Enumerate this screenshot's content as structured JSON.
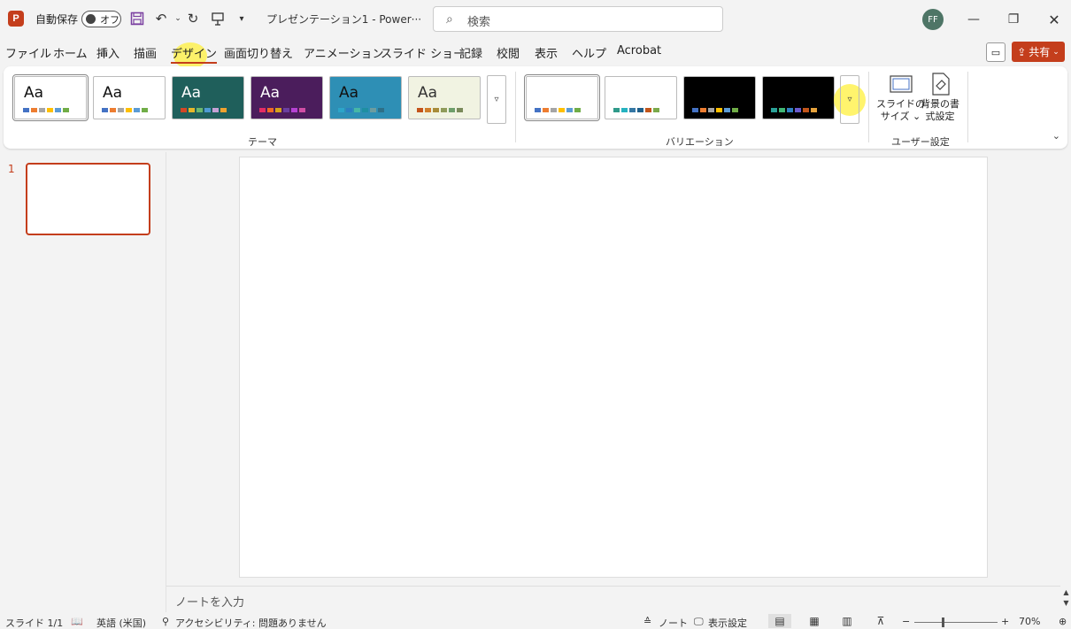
{
  "titlebar": {
    "logo_letter": "P",
    "autosave_label": "自動保存",
    "autosave_state": "オフ",
    "doc_title": "プレゼンテーション1  -  Power···",
    "search_placeholder": "検索",
    "avatar_initials": "FF",
    "qat_icons": [
      "save-icon",
      "undo-icon",
      "redo-icon",
      "present-icon",
      "customize-qat-icon"
    ]
  },
  "tabs": [
    {
      "label": "ファイル"
    },
    {
      "label": "ホーム"
    },
    {
      "label": "挿入"
    },
    {
      "label": "描画"
    },
    {
      "label": "デザイン"
    },
    {
      "label": "画面切り替え"
    },
    {
      "label": "アニメーション"
    },
    {
      "label": "スライド ショー"
    },
    {
      "label": "記録"
    },
    {
      "label": "校閲"
    },
    {
      "label": "表示"
    },
    {
      "label": "ヘルプ"
    },
    {
      "label": "Acrobat"
    }
  ],
  "active_tab": "デザイン",
  "share_label": "共有",
  "ribbon": {
    "themes_label": "テーマ",
    "variations_label": "バリエーション",
    "customize_label": "ユーザー設定",
    "theme_sample_text": "Aa",
    "themes": [
      {
        "bg": "#ffffff",
        "fg": "#111111",
        "colors": [
          "#4472c4",
          "#ed7d31",
          "#a5a5a5",
          "#ffc000",
          "#5b9bd5",
          "#70ad47"
        ]
      },
      {
        "bg": "#ffffff",
        "fg": "#111111",
        "colors": [
          "#4472c4",
          "#ed7d31",
          "#a5a5a5",
          "#ffc000",
          "#5b9bd5",
          "#70ad47"
        ]
      },
      {
        "bg": "#1f5f5b",
        "fg": "#ffffff",
        "colors": [
          "#d24726",
          "#e6b729",
          "#6bb76d",
          "#4e9ad3",
          "#c4a1d4",
          "#f0a22e"
        ]
      },
      {
        "bg": "#4b1d5c",
        "fg": "#ffffff",
        "colors": [
          "#e42c64",
          "#f06a24",
          "#d5a21b",
          "#6a3fa0",
          "#b542d3",
          "#d04ea4"
        ]
      },
      {
        "bg": "#2e8fb5",
        "fg": "#111111",
        "colors": [
          "#2ca5c9",
          "#2b7fc0",
          "#47b7a6",
          "#1e8fa2",
          "#6c9c9f",
          "#2d6f87"
        ]
      },
      {
        "bg": "#f1f3e2",
        "fg": "#333333",
        "colors": [
          "#c4541b",
          "#d07e2c",
          "#a88c3a",
          "#8f9b5a",
          "#6e9e6b",
          "#7a8a5b"
        ]
      }
    ],
    "variations": [
      {
        "bg": "#ffffff",
        "colors": [
          "#4472c4",
          "#ed7d31",
          "#a5a5a5",
          "#ffc000",
          "#5b9bd5",
          "#70ad47"
        ]
      },
      {
        "bg": "#ffffff",
        "colors": [
          "#2f9a8a",
          "#25b2c0",
          "#3577a4",
          "#1f5f8a",
          "#c2551a",
          "#7aa94a"
        ]
      },
      {
        "bg": "#000000",
        "colors": [
          "#4472c4",
          "#ed7d31",
          "#a5a5a5",
          "#ffc000",
          "#5b9bd5",
          "#70ad47"
        ]
      },
      {
        "bg": "#000000",
        "colors": [
          "#2aa198",
          "#3fb574",
          "#2f80c1",
          "#6a5acd",
          "#c2551a",
          "#e6a23c"
        ]
      }
    ],
    "slide_size_label_1": "スライドの",
    "slide_size_label_2": "サイズ ⌄",
    "bg_format_label_1": "背景の書",
    "bg_format_label_2": "式設定"
  },
  "slide_panel": {
    "slide_number": "1"
  },
  "notes_placeholder": "ノートを入力",
  "status": {
    "slide_info": "スライド 1/1",
    "language": "英語 (米国)",
    "accessibility": "アクセシビリティ: 問題ありません",
    "notes_label": "ノート",
    "display_settings": "表示設定",
    "zoom_minus": "−",
    "zoom_plus": "+",
    "zoom_level": "70%"
  },
  "colors": {
    "accent": "#c43e1c",
    "highlight": "#fff03c"
  }
}
